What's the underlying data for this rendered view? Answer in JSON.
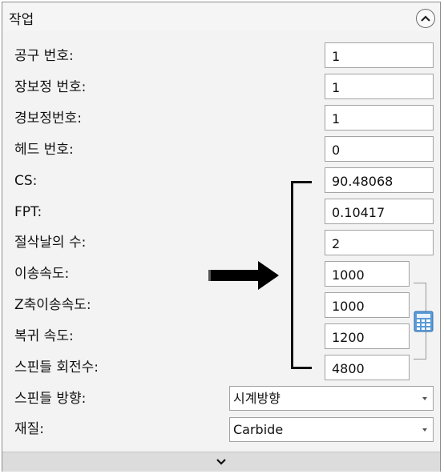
{
  "header": {
    "title": "작업"
  },
  "fields": [
    {
      "label": "공구 번호:",
      "value": "1"
    },
    {
      "label": "장보정 번호:",
      "value": "1"
    },
    {
      "label": "경보정번호:",
      "value": "1"
    },
    {
      "label": "헤드 번호:",
      "value": "0"
    },
    {
      "label": "CS:",
      "value": "90.48068"
    },
    {
      "label": "FPT:",
      "value": "0.10417"
    },
    {
      "label": "절삭날의 수:",
      "value": "2"
    },
    {
      "label": "이송속도:",
      "value": "1000"
    },
    {
      "label": "Z축이송속도:",
      "value": "1000"
    },
    {
      "label": "복귀 속도:",
      "value": "1200"
    },
    {
      "label": "스핀들 회전수:",
      "value": "4800"
    }
  ],
  "dropdowns": [
    {
      "label": "스핀들 방향:",
      "value": "시계방향"
    },
    {
      "label": "재질:",
      "value": "Carbide"
    }
  ],
  "icons": {
    "collapse": "chevron-up-icon",
    "expand": "chevron-down-icon",
    "arrow": "right-arrow-icon",
    "calculator": "calculator-icon"
  }
}
